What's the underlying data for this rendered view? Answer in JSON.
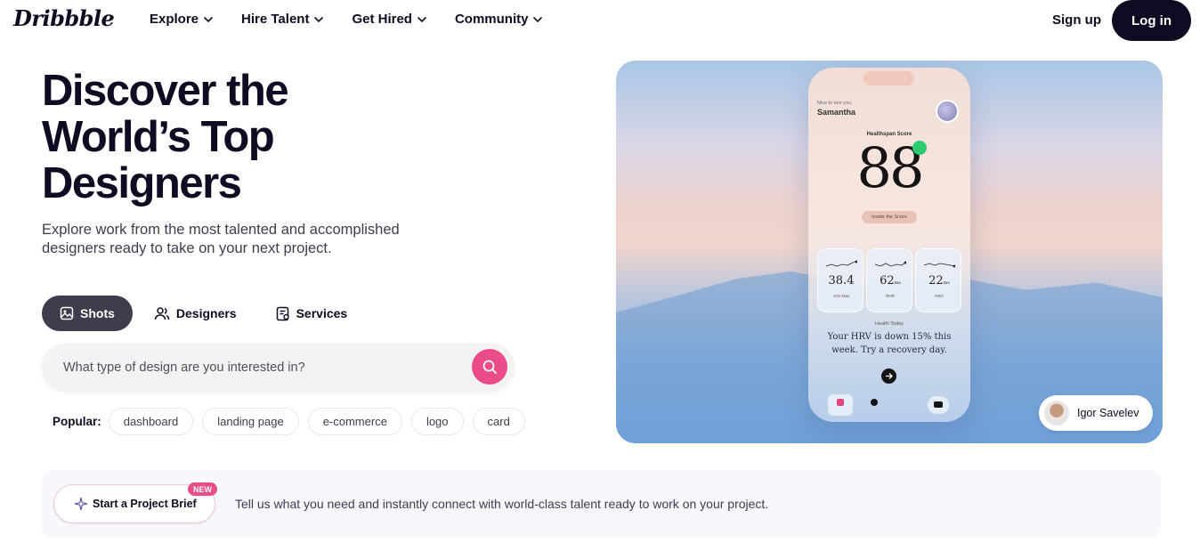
{
  "brand": {
    "logo_text": "Dribbble"
  },
  "nav": {
    "items": [
      {
        "label": "Explore"
      },
      {
        "label": "Hire Talent"
      },
      {
        "label": "Get Hired"
      },
      {
        "label": "Community"
      }
    ],
    "signup_label": "Sign up",
    "login_label": "Log in"
  },
  "hero": {
    "title": "Discover the World’s Top Designers",
    "subtitle": "Explore work from the most talented and accomplished designers ready to take on your next project.",
    "tabs": [
      {
        "label": "Shots",
        "icon": "image-icon",
        "active": true
      },
      {
        "label": "Designers",
        "icon": "users-icon",
        "active": false
      },
      {
        "label": "Services",
        "icon": "services-icon",
        "active": false
      }
    ],
    "search": {
      "placeholder": "What type of design are you interested in?",
      "value": ""
    },
    "popular_label": "Popular:",
    "popular_tags": [
      "dashboard",
      "landing page",
      "e-commerce",
      "logo",
      "card"
    ]
  },
  "showcase": {
    "phone": {
      "greeting": "Nice to see you,",
      "name": "Samantha",
      "score_label": "Healthspan Score",
      "score": "88",
      "pill": "Inside the Score",
      "stats": [
        {
          "value": "38.4",
          "label": "VO2 Max"
        },
        {
          "value": "62",
          "unit": "ms",
          "label": "RHR"
        },
        {
          "value": "22",
          "unit": "ms",
          "label": "HRV"
        }
      ],
      "footer_label": "Health Today",
      "message": "Your HRV is down 15% this week. Try a recovery day."
    },
    "credit_name": "Igor Savelev"
  },
  "brief": {
    "button_label": "Start a Project Brief",
    "badge": "NEW",
    "text": "Tell us what you need and instantly connect with world-class talent ready to work on your project."
  },
  "colors": {
    "accent": "#ea4c89",
    "dark": "#0d0c22",
    "text": "#3d3d4e"
  }
}
